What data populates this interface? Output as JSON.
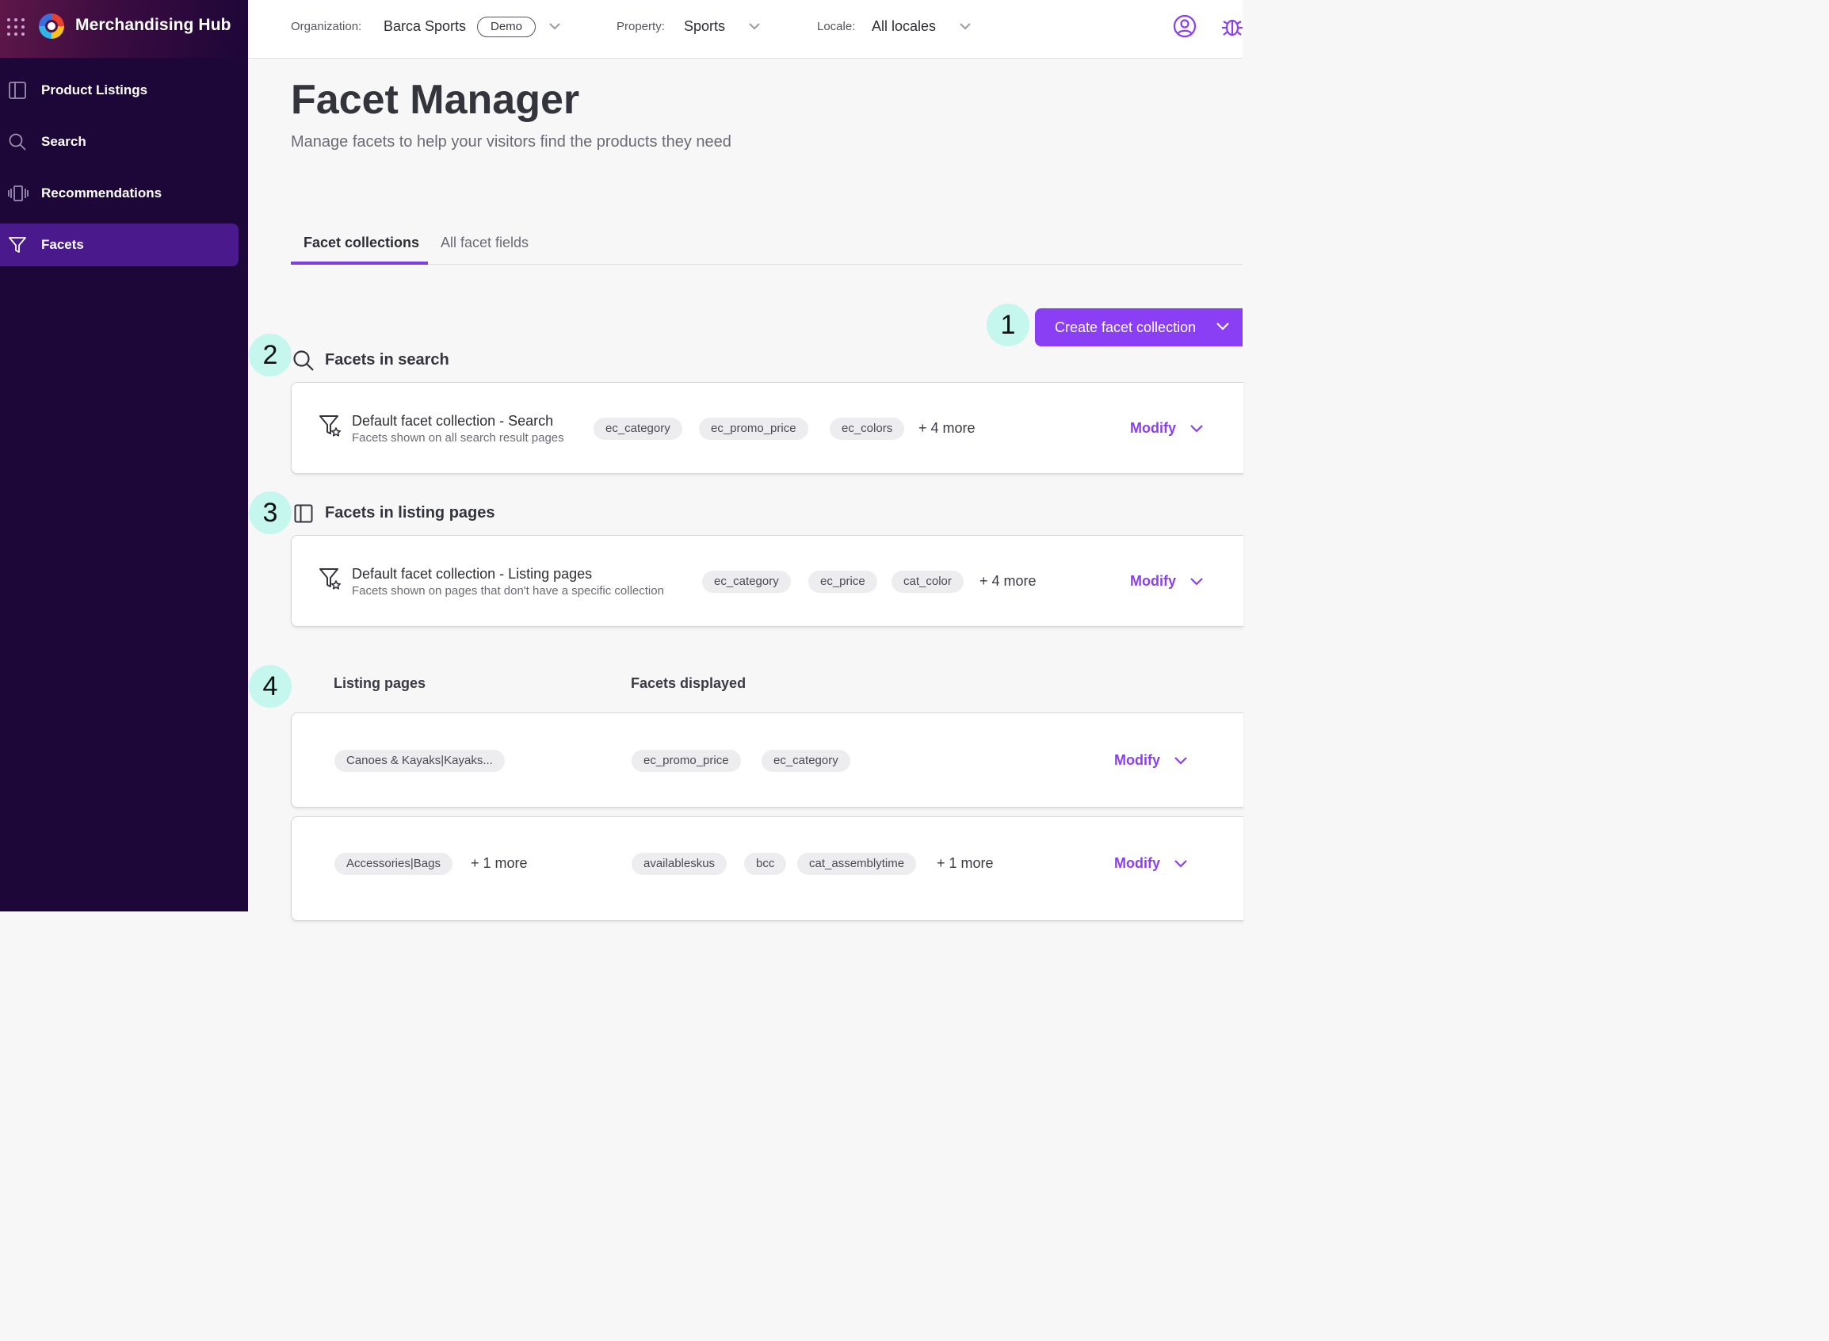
{
  "app": {
    "name": "Merchandising Hub"
  },
  "sidebar": {
    "items": [
      {
        "label": "Product Listings",
        "icon": "sidebar-panel-icon",
        "active": false
      },
      {
        "label": "Search",
        "icon": "search-icon",
        "active": false
      },
      {
        "label": "Recommendations",
        "icon": "carousel-icon",
        "active": false
      },
      {
        "label": "Facets",
        "icon": "filter-icon",
        "active": true
      }
    ]
  },
  "topbar": {
    "organization_label": "Organization:",
    "organization_value": "Barca Sports",
    "demo_badge": "Demo",
    "property_label": "Property:",
    "property_value": "Sports",
    "locale_label": "Locale:",
    "locale_value": "All locales"
  },
  "page": {
    "title": "Facet Manager",
    "subtitle": "Manage facets to help your visitors find the products they need"
  },
  "tabs": [
    {
      "label": "Facet collections",
      "active": true
    },
    {
      "label": "All facet fields",
      "active": false
    }
  ],
  "callouts": [
    "1",
    "2",
    "3",
    "4"
  ],
  "create_button": {
    "label": "Create facet collection"
  },
  "search_section": {
    "heading": "Facets in search",
    "card": {
      "title": "Default facet collection - Search",
      "description": "Facets shown on all search result pages",
      "chips": [
        "ec_category",
        "ec_promo_price",
        "ec_colors"
      ],
      "more": "+ 4 more",
      "modify": "Modify"
    }
  },
  "listing_section": {
    "heading": "Facets in listing pages",
    "card": {
      "title": "Default facet collection - Listing pages",
      "description": "Facets shown on pages that don't have a specific collection",
      "chips": [
        "ec_category",
        "ec_price",
        "cat_color"
      ],
      "more": "+ 4 more",
      "modify": "Modify"
    }
  },
  "listing_table": {
    "col_pages": "Listing pages",
    "col_facets": "Facets displayed",
    "rows": [
      {
        "pages": [
          "Canoes & Kayaks|Kayaks..."
        ],
        "pages_more": "",
        "facets": [
          "ec_promo_price",
          "ec_category"
        ],
        "facets_more": "",
        "modify": "Modify"
      },
      {
        "pages": [
          "Accessories|Bags"
        ],
        "pages_more": "+ 1 more",
        "facets": [
          "availableskus",
          "bcc",
          "cat_assemblytime"
        ],
        "facets_more": "+ 1 more",
        "modify": "Modify"
      }
    ]
  },
  "colors": {
    "sidebar_bg": "#1d0638",
    "accent": "#8a3ff4",
    "active_nav": "#4a1a8c",
    "callout_bg": "#c6f7ef"
  }
}
